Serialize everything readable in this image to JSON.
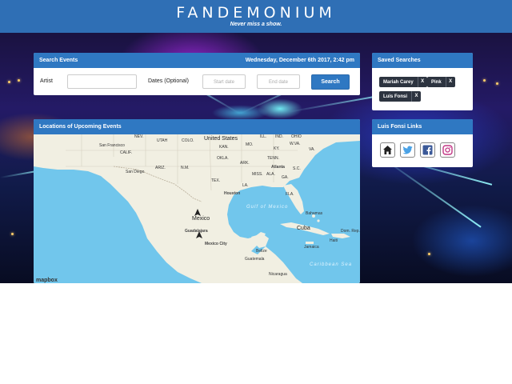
{
  "header": {
    "brand": "FANDEMONIUM",
    "tagline": "Never miss a show."
  },
  "search": {
    "title": "Search Events",
    "date_display": "Wednesday, December 6th 2017, 2:42 pm",
    "artist_label": "Artist",
    "artist_value": "",
    "dates_label": "Dates (Optional)",
    "start_placeholder": "Start date",
    "end_placeholder": "End date",
    "button_label": "Search"
  },
  "saved": {
    "title": "Saved Searches",
    "items": [
      {
        "label": "Mariah Carey",
        "remove": "X"
      },
      {
        "label": "Pink",
        "remove": "X"
      },
      {
        "label": "Luis Fonsi",
        "remove": "X"
      }
    ]
  },
  "links": {
    "title": "Luis Fonsi Links",
    "icons": [
      "home-icon",
      "twitter-icon",
      "facebook-icon",
      "instagram-icon"
    ]
  },
  "map": {
    "title": "Locations of Upcoming Events",
    "attribution": "mapbox",
    "labels": {
      "united_states": "United States",
      "mexico": "Mexico",
      "cuba": "Cuba",
      "gulf": "Gulf of Mexico",
      "caribbean": "Caribbean Sea",
      "san_francisco": "San Francisco",
      "calif": "CALIF.",
      "san_diego": "San Diego",
      "ariz": "ARIZ.",
      "nm": "N.M.",
      "tex": "TEX.",
      "okla": "OKLA.",
      "ark": "ARK.",
      "la": "LA.",
      "miss": "MISS.",
      "ala": "ALA.",
      "tenn": "TENN.",
      "ky": "KY.",
      "ga": "GA.",
      "sc": "S.C.",
      "va": "VA.",
      "wva": "W.VA.",
      "fla": "FLA.",
      "colo": "COLO.",
      "utah": "UTAH",
      "nev": "NEV.",
      "kan": "KAN.",
      "mo": "MO.",
      "ill": "ILL.",
      "ind": "IND.",
      "ohio": "OHIO",
      "atlanta": "Atlanta",
      "houston": "Houston",
      "guadalajara": "Guadalajara",
      "mexico_city": "Mexico City",
      "belize": "Belize",
      "guatemala": "Guatemala",
      "nicaragua": "Nicaragua",
      "bahamas": "Bahamas",
      "jamaica": "Jamaica",
      "haiti": "Haiti",
      "dr": "Dom. Rep."
    }
  },
  "colors": {
    "header_bg": "#2f6fb5",
    "panel_header": "#2f78c2",
    "tag_bg": "#2d3440",
    "water": "#71c6ec",
    "land": "#f1efe2"
  }
}
